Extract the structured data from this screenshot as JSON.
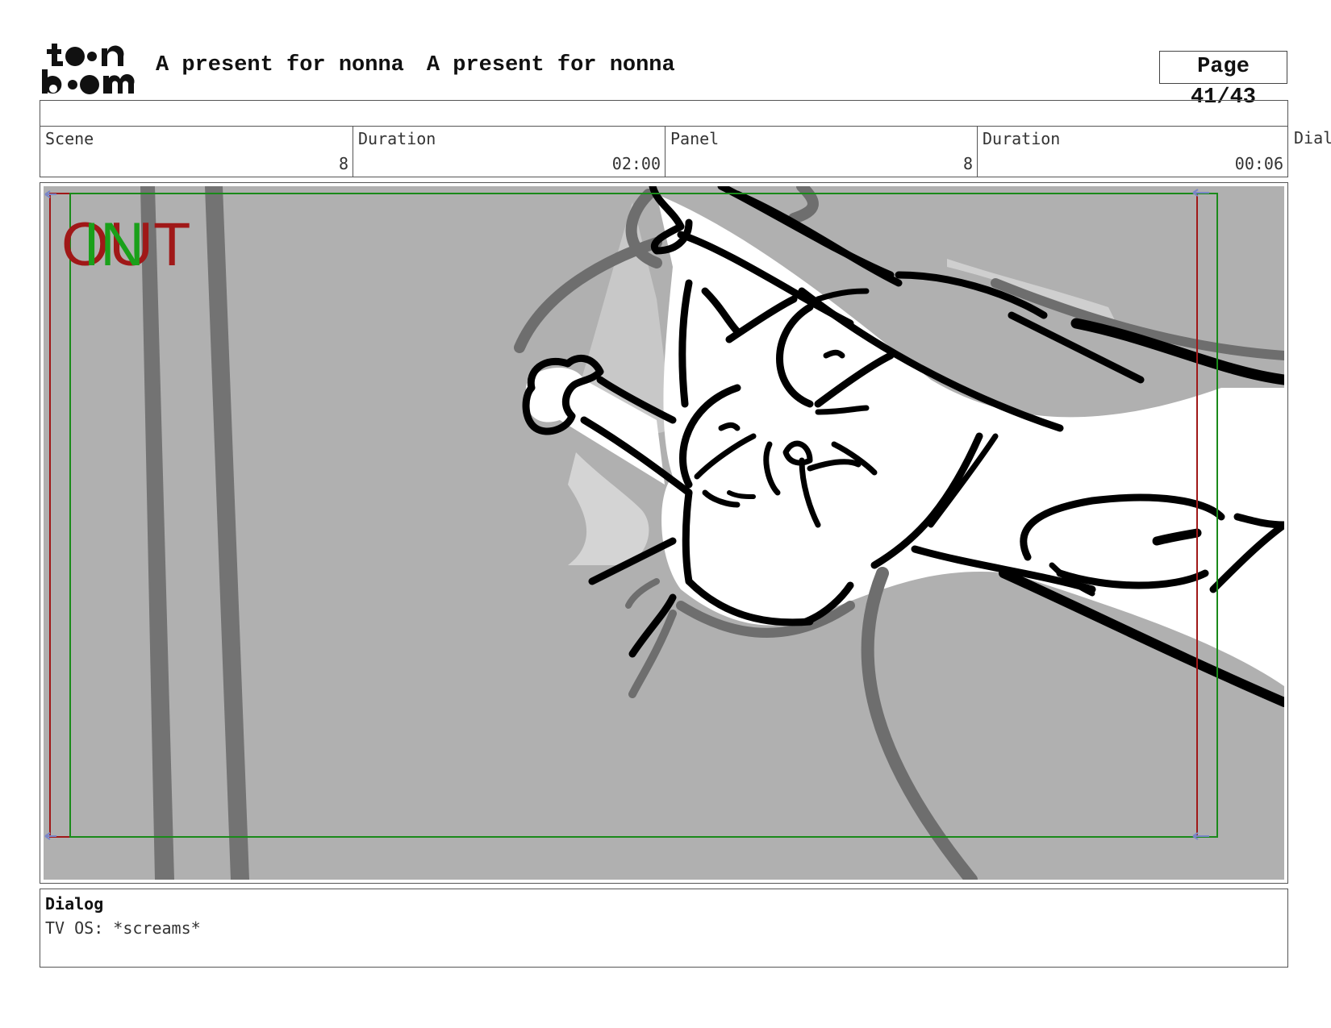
{
  "header": {
    "logo_text": "toon boom",
    "project_title_1": "A present for nonna",
    "project_title_2": "A present for nonna",
    "page_label": "Page 41/43"
  },
  "info": {
    "scene_label": "Scene",
    "scene_value": "8",
    "scene_duration_label": "Duration",
    "scene_duration_value": "02:00",
    "panel_label": "Panel",
    "panel_value": "8",
    "panel_duration_label": "Duration",
    "panel_duration_value": "00:06",
    "dialog_overflow_label": "Dial"
  },
  "panel": {
    "out_label": "OUT",
    "in_label": "IN",
    "colors": {
      "background": "#b0b0b0",
      "out_frame": "#a01818",
      "in_frame": "#1a8a1a",
      "ink": "#000000",
      "shadow": "#707070"
    }
  },
  "dialog": {
    "heading": "Dialog",
    "text": "TV OS: *screams*"
  }
}
